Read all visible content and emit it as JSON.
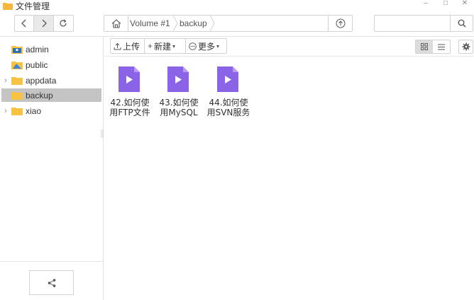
{
  "window": {
    "title": "文件管理",
    "minimize": "–",
    "maximize": "□",
    "close": "✕"
  },
  "nav": {
    "back_icon": "chevron-left-icon",
    "forward_icon": "chevron-right-icon",
    "refresh_icon": "refresh-icon"
  },
  "path": {
    "crumbs": [
      "Volume #1",
      "backup"
    ]
  },
  "search": {
    "placeholder": "",
    "value": ""
  },
  "sidebar": {
    "items": [
      {
        "label": "admin",
        "icon": "user-folder-icon",
        "expandable": false,
        "selected": false
      },
      {
        "label": "public",
        "icon": "public-folder-icon",
        "expandable": false,
        "selected": false
      },
      {
        "label": "appdata",
        "icon": "folder-icon",
        "expandable": true,
        "selected": false
      },
      {
        "label": "backup",
        "icon": "folder-icon",
        "expandable": false,
        "selected": true
      },
      {
        "label": "xiao",
        "icon": "folder-icon",
        "expandable": true,
        "selected": false
      }
    ]
  },
  "actions": {
    "upload": "上传",
    "new": "新建",
    "more": "更多"
  },
  "files": [
    {
      "name": "42.如何使用FTP文件",
      "icon": "video-file-icon"
    },
    {
      "name": "43.如何使用MySQL",
      "icon": "video-file-icon"
    },
    {
      "name": "44.如何使用SVN服务",
      "icon": "video-file-icon"
    }
  ],
  "colors": {
    "folder": "#f5c242",
    "video_icon": "#8b63e6",
    "selected_row": "#c4c4c4"
  }
}
